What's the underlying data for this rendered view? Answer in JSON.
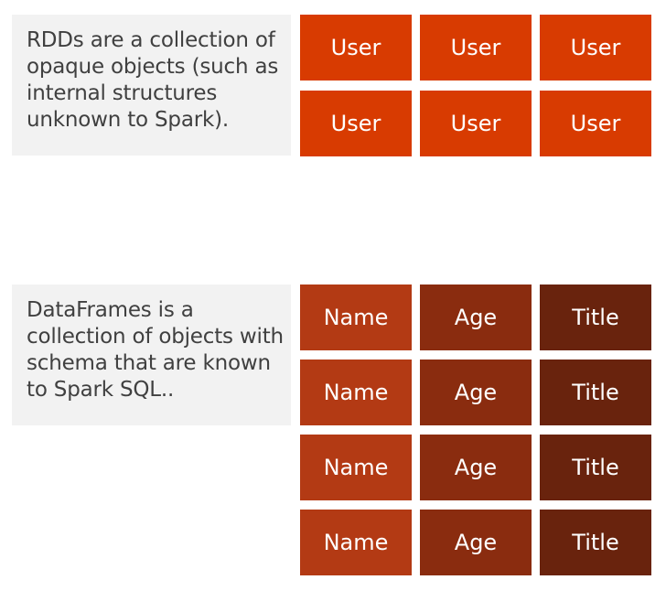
{
  "rdd": {
    "description": "RDDs are a collection of opaque objects (such as internal structures unknown to Spark).",
    "cells": [
      [
        "User",
        "User",
        "User"
      ],
      [
        "User",
        "User",
        "User"
      ]
    ],
    "color": "#d83b01"
  },
  "dataframe": {
    "description": "DataFrames is a collection of objects with schema that are known to Spark SQL..",
    "cells": [
      [
        "Name",
        "Age",
        "Title"
      ],
      [
        "Name",
        "Age",
        "Title"
      ],
      [
        "Name",
        "Age",
        "Title"
      ],
      [
        "Name",
        "Age",
        "Title"
      ]
    ],
    "column_colors": [
      "#b33a14",
      "#8a2c0f",
      "#69230d"
    ]
  }
}
